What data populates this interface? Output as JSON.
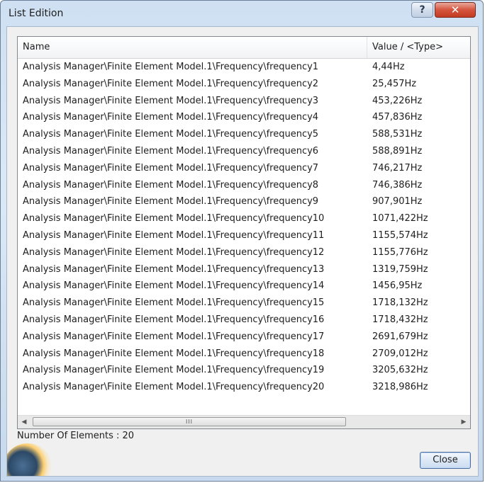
{
  "window": {
    "title": "List Edition",
    "help_label": "?",
    "close_label": "✕"
  },
  "list": {
    "columns": {
      "name": "Name",
      "value": "Value / <Type>"
    },
    "rows": [
      {
        "name": "Analysis Manager\\Finite Element Model.1\\Frequency\\frequency1",
        "value": "4,44Hz"
      },
      {
        "name": "Analysis Manager\\Finite Element Model.1\\Frequency\\frequency2",
        "value": "25,457Hz"
      },
      {
        "name": "Analysis Manager\\Finite Element Model.1\\Frequency\\frequency3",
        "value": "453,226Hz"
      },
      {
        "name": "Analysis Manager\\Finite Element Model.1\\Frequency\\frequency4",
        "value": "457,836Hz"
      },
      {
        "name": "Analysis Manager\\Finite Element Model.1\\Frequency\\frequency5",
        "value": "588,531Hz"
      },
      {
        "name": "Analysis Manager\\Finite Element Model.1\\Frequency\\frequency6",
        "value": "588,891Hz"
      },
      {
        "name": "Analysis Manager\\Finite Element Model.1\\Frequency\\frequency7",
        "value": "746,217Hz"
      },
      {
        "name": "Analysis Manager\\Finite Element Model.1\\Frequency\\frequency8",
        "value": "746,386Hz"
      },
      {
        "name": "Analysis Manager\\Finite Element Model.1\\Frequency\\frequency9",
        "value": "907,901Hz"
      },
      {
        "name": "Analysis Manager\\Finite Element Model.1\\Frequency\\frequency10",
        "value": "1071,422Hz"
      },
      {
        "name": "Analysis Manager\\Finite Element Model.1\\Frequency\\frequency11",
        "value": "1155,574Hz"
      },
      {
        "name": "Analysis Manager\\Finite Element Model.1\\Frequency\\frequency12",
        "value": "1155,776Hz"
      },
      {
        "name": "Analysis Manager\\Finite Element Model.1\\Frequency\\frequency13",
        "value": "1319,759Hz"
      },
      {
        "name": "Analysis Manager\\Finite Element Model.1\\Frequency\\frequency14",
        "value": "1456,95Hz"
      },
      {
        "name": "Analysis Manager\\Finite Element Model.1\\Frequency\\frequency15",
        "value": "1718,132Hz"
      },
      {
        "name": "Analysis Manager\\Finite Element Model.1\\Frequency\\frequency16",
        "value": "1718,432Hz"
      },
      {
        "name": "Analysis Manager\\Finite Element Model.1\\Frequency\\frequency17",
        "value": "2691,679Hz"
      },
      {
        "name": "Analysis Manager\\Finite Element Model.1\\Frequency\\frequency18",
        "value": "2709,012Hz"
      },
      {
        "name": "Analysis Manager\\Finite Element Model.1\\Frequency\\frequency19",
        "value": "3205,632Hz"
      },
      {
        "name": "Analysis Manager\\Finite Element Model.1\\Frequency\\frequency20",
        "value": "3218,986Hz"
      }
    ],
    "scrollbar": {
      "left_arrow": "◀",
      "right_arrow": "▶",
      "grip": "III"
    }
  },
  "footer": {
    "count_text": "Number Of Elements : 20",
    "close_button": "Close"
  },
  "icons": {
    "help": "question-icon",
    "close": "close-icon",
    "scroll_left": "arrow-left-icon",
    "scroll_right": "arrow-right-icon",
    "app_logo": "globe-logo-icon"
  },
  "colors": {
    "title_close": "#c23b22",
    "frame": "#cfe0f3",
    "client": "#f0f0f0"
  }
}
